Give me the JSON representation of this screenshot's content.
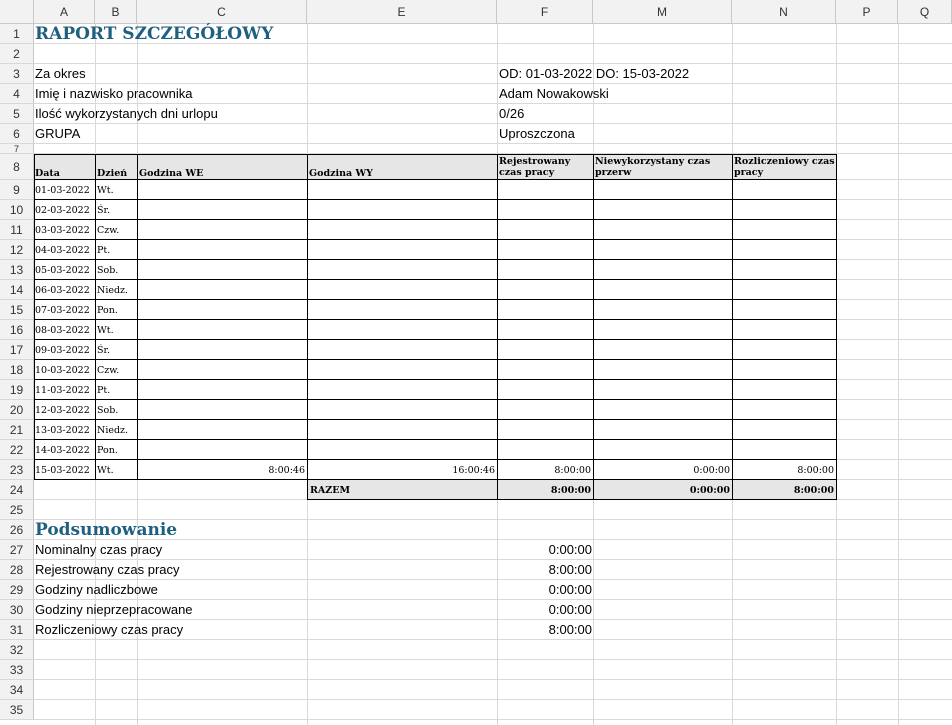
{
  "columns": [
    "A",
    "B",
    "C",
    "E",
    "F",
    "M",
    "N",
    "P",
    "Q"
  ],
  "rows": [
    "1",
    "2",
    "3",
    "4",
    "5",
    "6",
    "7",
    "8",
    "9",
    "10",
    "11",
    "12",
    "13",
    "14",
    "15",
    "16",
    "17",
    "18",
    "19",
    "20",
    "21",
    "22",
    "23",
    "24",
    "25",
    "26",
    "27",
    "28",
    "29",
    "30",
    "31",
    "32",
    "33",
    "34",
    "35"
  ],
  "report": {
    "title": "RAPORT SZCZEGÓŁOWY",
    "period_label": "Za okres",
    "period_value": "OD: 01-03-2022 DO: 15-03-2022",
    "employee_label": "Imię i nazwisko pracownika",
    "employee_value": "Adam Nowakowski",
    "leave_label": "Ilość wykorzystanych dni urlopu",
    "leave_value": "0/26",
    "group_label": "GRUPA",
    "group_value": "Uproszczona"
  },
  "table": {
    "headers": {
      "date": "Data",
      "day": "Dzień",
      "time_in": "Godzina WE",
      "time_out": "Godzina WY",
      "registered_1": "Rejestrowany",
      "registered_2": "czas pracy",
      "unused_break_1": "Niewykorzystany czas",
      "unused_break_2": "przerw",
      "settled_1": "Rozliczeniowy czas",
      "settled_2": "pracy"
    },
    "rows": [
      {
        "date": "01-03-2022",
        "day": "Wt.",
        "in": "",
        "out": "",
        "reg": "",
        "unused": "",
        "settled": ""
      },
      {
        "date": "02-03-2022",
        "day": "Śr.",
        "in": "",
        "out": "",
        "reg": "",
        "unused": "",
        "settled": ""
      },
      {
        "date": "03-03-2022",
        "day": "Czw.",
        "in": "",
        "out": "",
        "reg": "",
        "unused": "",
        "settled": ""
      },
      {
        "date": "04-03-2022",
        "day": "Pt.",
        "in": "",
        "out": "",
        "reg": "",
        "unused": "",
        "settled": ""
      },
      {
        "date": "05-03-2022",
        "day": "Sob.",
        "in": "",
        "out": "",
        "reg": "",
        "unused": "",
        "settled": ""
      },
      {
        "date": "06-03-2022",
        "day": "Niedz.",
        "in": "",
        "out": "",
        "reg": "",
        "unused": "",
        "settled": ""
      },
      {
        "date": "07-03-2022",
        "day": "Pon.",
        "in": "",
        "out": "",
        "reg": "",
        "unused": "",
        "settled": ""
      },
      {
        "date": "08-03-2022",
        "day": "Wt.",
        "in": "",
        "out": "",
        "reg": "",
        "unused": "",
        "settled": ""
      },
      {
        "date": "09-03-2022",
        "day": "Śr.",
        "in": "",
        "out": "",
        "reg": "",
        "unused": "",
        "settled": ""
      },
      {
        "date": "10-03-2022",
        "day": "Czw.",
        "in": "",
        "out": "",
        "reg": "",
        "unused": "",
        "settled": ""
      },
      {
        "date": "11-03-2022",
        "day": "Pt.",
        "in": "",
        "out": "",
        "reg": "",
        "unused": "",
        "settled": ""
      },
      {
        "date": "12-03-2022",
        "day": "Sob.",
        "in": "",
        "out": "",
        "reg": "",
        "unused": "",
        "settled": ""
      },
      {
        "date": "13-03-2022",
        "day": "Niedz.",
        "in": "",
        "out": "",
        "reg": "",
        "unused": "",
        "settled": ""
      },
      {
        "date": "14-03-2022",
        "day": "Pon.",
        "in": "",
        "out": "",
        "reg": "",
        "unused": "",
        "settled": ""
      },
      {
        "date": "15-03-2022",
        "day": "Wt.",
        "in": "8:00:46",
        "out": "16:00:46",
        "reg": "8:00:00",
        "unused": "0:00:00",
        "settled": "8:00:00"
      }
    ],
    "total": {
      "label": "RAZEM",
      "reg": "8:00:00",
      "unused": "0:00:00",
      "settled": "8:00:00"
    }
  },
  "summary": {
    "title": "Podsumowanie",
    "items": [
      {
        "label": "Nominalny czas pracy",
        "value": "0:00:00"
      },
      {
        "label": "Rejestrowany czas pracy",
        "value": "8:00:00"
      },
      {
        "label": "Godziny nadliczbowe",
        "value": "0:00:00"
      },
      {
        "label": "Godziny nieprzepracowane",
        "value": "0:00:00"
      },
      {
        "label": "Rozliczeniowy czas pracy",
        "value": "8:00:00"
      }
    ]
  }
}
